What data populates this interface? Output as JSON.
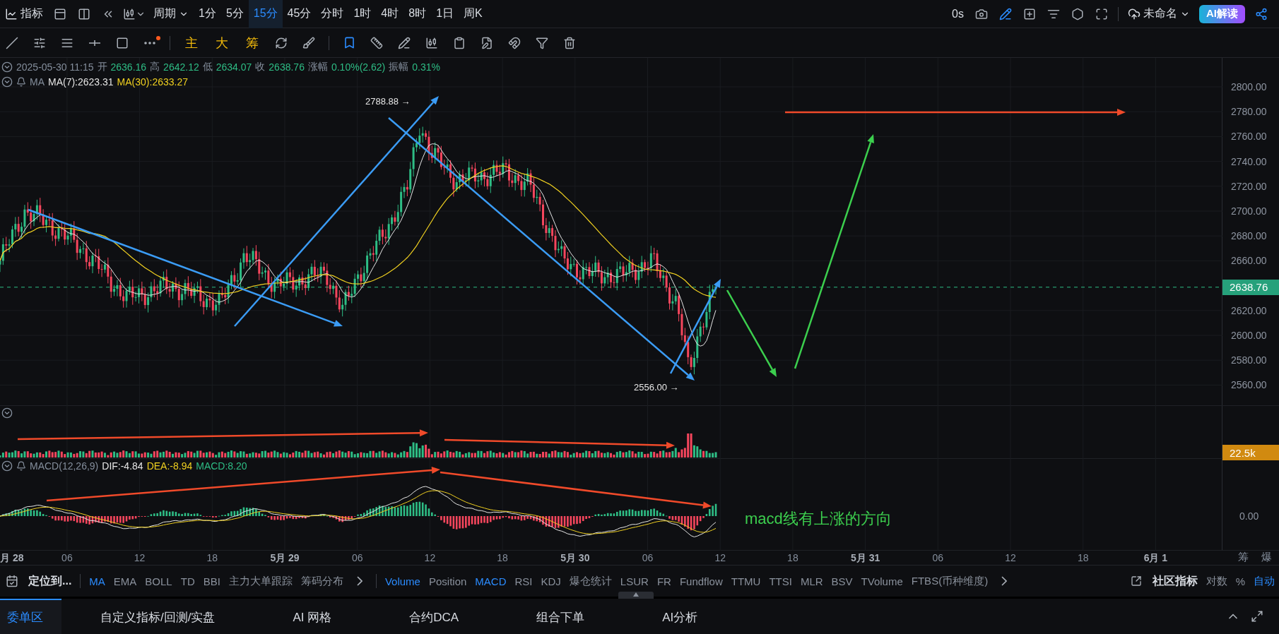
{
  "toolbar": {
    "indicator_button": "指标",
    "period_label": "周期",
    "intervals": [
      {
        "label": "1分",
        "selected": false
      },
      {
        "label": "5分",
        "selected": false
      },
      {
        "label": "15分",
        "selected": true
      },
      {
        "label": "45分",
        "selected": false
      },
      {
        "label": "分时",
        "selected": false
      },
      {
        "label": "1时",
        "selected": false
      },
      {
        "label": "4时",
        "selected": false
      },
      {
        "label": "8时",
        "selected": false
      },
      {
        "label": "1日",
        "selected": false
      },
      {
        "label": "周K",
        "selected": false
      }
    ],
    "timer": "0s",
    "layout_name": "未命名",
    "ai_button": "AI解读"
  },
  "drawing_tools": {
    "text_tools": [
      "主",
      "大",
      "筹"
    ]
  },
  "legend": {
    "datetime": "2025-05-30 11:15",
    "ohlc": [
      {
        "label": "开",
        "value": "2636.16"
      },
      {
        "label": "高",
        "value": "2642.12"
      },
      {
        "label": "低",
        "value": "2634.07"
      },
      {
        "label": "收",
        "value": "2638.76"
      }
    ],
    "change_label": "涨幅",
    "change": "0.10%(2.62)",
    "amplitude_label": "振幅",
    "amplitude": "0.31%"
  },
  "ma_legend": {
    "name": "MA",
    "ma7": "MA(7):2623.31",
    "ma30": "MA(30):2633.27"
  },
  "price_axis": {
    "ticks": [
      "2800.00",
      "2780.00",
      "2760.00",
      "2740.00",
      "2720.00",
      "2700.00",
      "2680.00",
      "2660.00",
      "2620.00",
      "2600.00",
      "2580.00",
      "2560.00"
    ],
    "last_price": "2638.76"
  },
  "annotations": {
    "high": "2788.88 →",
    "low": "2556.00 →"
  },
  "volume_axis": "22.5k",
  "macd_legend": {
    "name": "MACD(12,26,9)",
    "dif": "DIF:-4.84",
    "dea": "DEA:-8.94",
    "macd": "MACD:8.20"
  },
  "macd_axis": "0.00",
  "macd_note": "macd线有上涨的方向",
  "time_axis": [
    {
      "label": "月 28",
      "kind": "day"
    },
    {
      "label": "06",
      "kind": "hour"
    },
    {
      "label": "12",
      "kind": "hour"
    },
    {
      "label": "18",
      "kind": "hour"
    },
    {
      "label": "5月 29",
      "kind": "day"
    },
    {
      "label": "06",
      "kind": "hour"
    },
    {
      "label": "12",
      "kind": "hour"
    },
    {
      "label": "18",
      "kind": "hour"
    },
    {
      "label": "5月 30",
      "kind": "day"
    },
    {
      "label": "06",
      "kind": "hour"
    },
    {
      "label": "12",
      "kind": "hour"
    },
    {
      "label": "18",
      "kind": "hour"
    },
    {
      "label": "5月 31",
      "kind": "day"
    },
    {
      "label": "06",
      "kind": "hour"
    },
    {
      "label": "12",
      "kind": "hour"
    },
    {
      "label": "18",
      "kind": "hour"
    },
    {
      "label": "6月 1",
      "kind": "day"
    }
  ],
  "axis_corner": [
    "筹",
    "爆"
  ],
  "indicator_bar": {
    "locate": "定位到...",
    "main_indicators": [
      {
        "label": "MA",
        "selected": true
      },
      {
        "label": "EMA",
        "selected": false
      },
      {
        "label": "BOLL",
        "selected": false
      },
      {
        "label": "TD",
        "selected": false
      },
      {
        "label": "BBI",
        "selected": false
      },
      {
        "label": "主力大单跟踪",
        "selected": false
      },
      {
        "label": "筹码分布",
        "selected": false
      }
    ],
    "sub_indicators": [
      {
        "label": "Volume",
        "selected": true
      },
      {
        "label": "Position",
        "selected": false
      },
      {
        "label": "MACD",
        "selected": true
      },
      {
        "label": "RSI",
        "selected": false
      },
      {
        "label": "KDJ",
        "selected": false
      },
      {
        "label": "爆仓统计",
        "selected": false
      },
      {
        "label": "LSUR",
        "selected": false
      },
      {
        "label": "FR",
        "selected": false
      },
      {
        "label": "Fundflow",
        "selected": false
      },
      {
        "label": "TTMU",
        "selected": false
      },
      {
        "label": "TTSI",
        "selected": false
      },
      {
        "label": "MLR",
        "selected": false
      },
      {
        "label": "BSV",
        "selected": false
      },
      {
        "label": "TVolume",
        "selected": false
      },
      {
        "label": "FTBS(币种维度)",
        "selected": false
      }
    ],
    "community": "社区指标",
    "scale_options": [
      {
        "label": "对数",
        "selected": false
      },
      {
        "label": "%",
        "selected": false
      },
      {
        "label": "自动",
        "selected": true
      }
    ]
  },
  "bottom_tabs": [
    {
      "label": "委单区",
      "selected": true
    },
    {
      "label": "自定义指标/回测/实盘",
      "selected": false
    },
    {
      "label": "AI 网格",
      "selected": false
    },
    {
      "label": "合约DCA",
      "selected": false
    },
    {
      "label": "组合下单",
      "selected": false
    },
    {
      "label": "AI分析",
      "selected": false
    }
  ]
}
